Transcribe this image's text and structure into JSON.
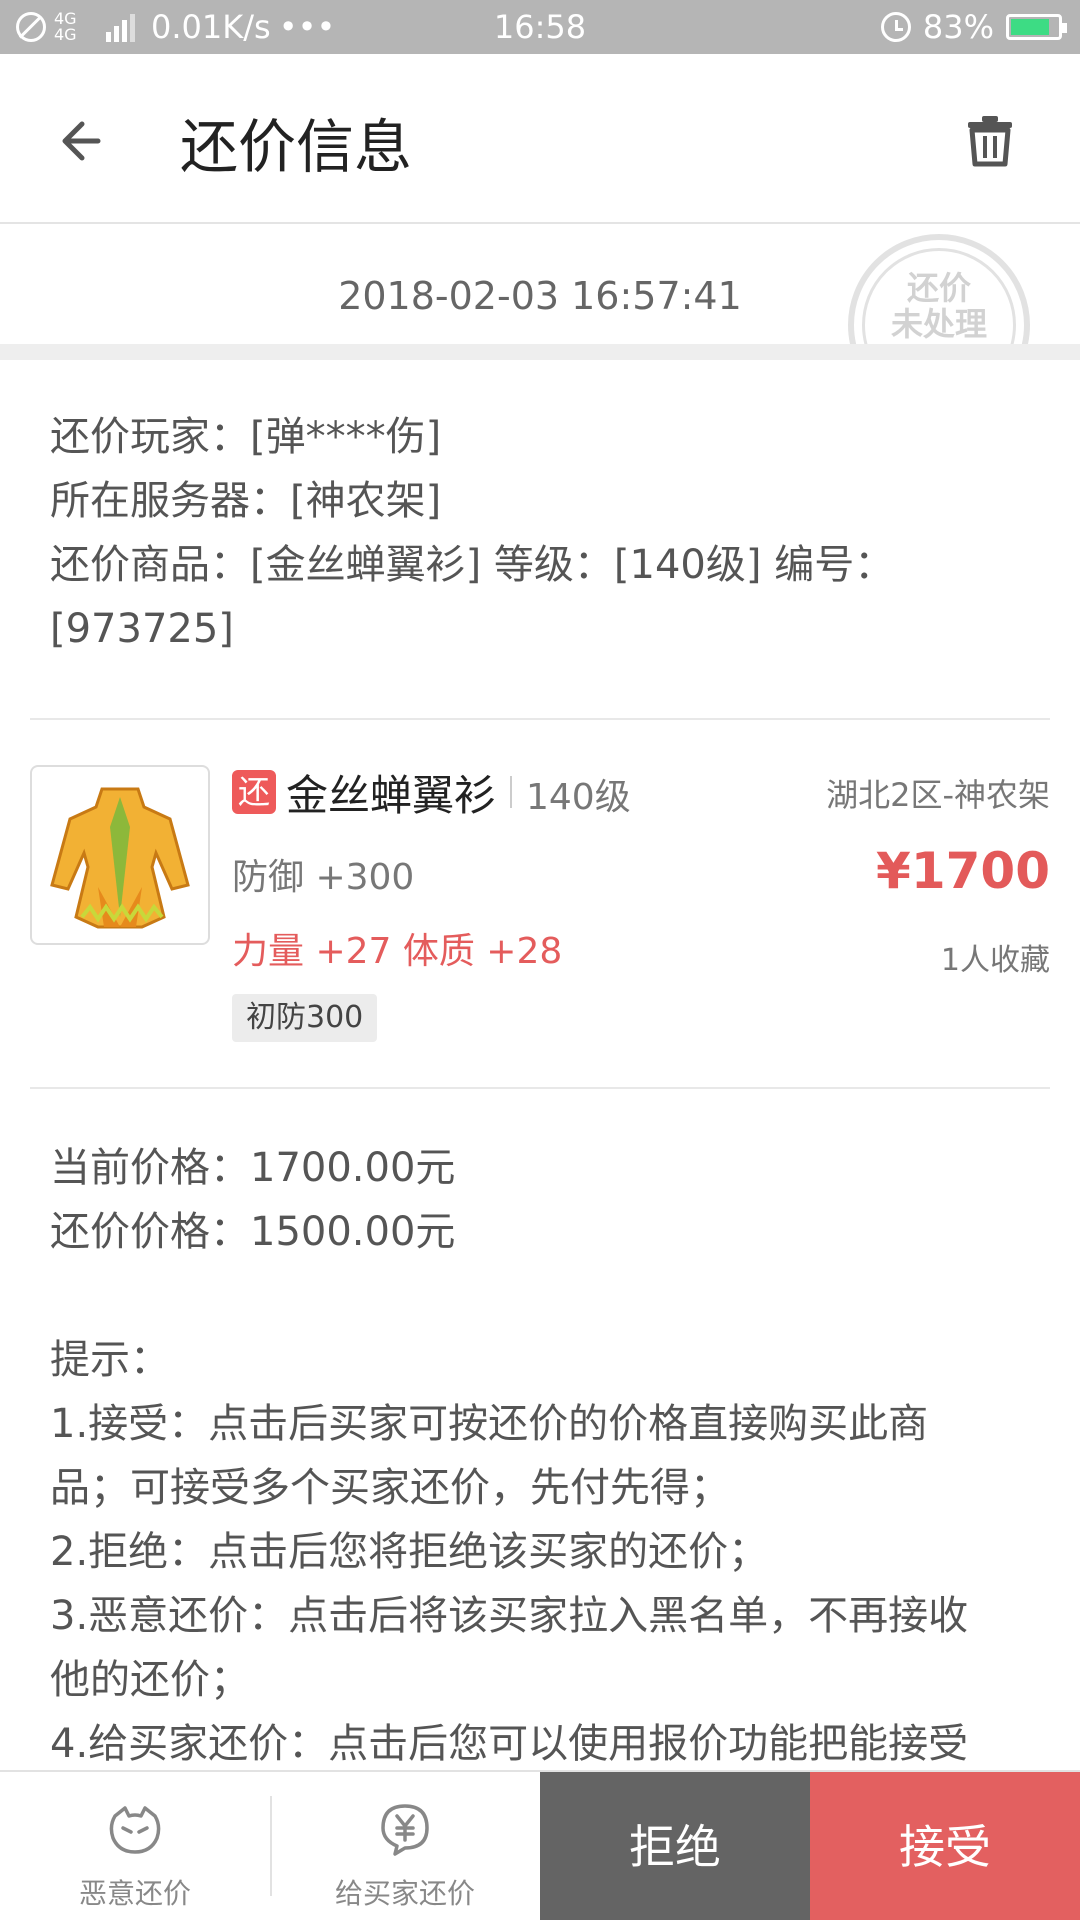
{
  "status_bar": {
    "network": "4G 4G",
    "speed": "0.01K/s",
    "more": "•••",
    "time": "16:58",
    "battery_text": "83%",
    "battery_level": 0.83
  },
  "header": {
    "title": "还价信息"
  },
  "offer_card": {
    "time": "2018-02-03 16:57:41",
    "stamp_line1": "还价",
    "stamp_line2": "未处理"
  },
  "info": {
    "player": "还价玩家：[弹****伤]",
    "server": "所在服务器：[神农架]",
    "goods_line1": "还价商品：[金丝蝉翼衫] 等级：[140级] 编号：",
    "goods_line2": "[973725]"
  },
  "item": {
    "tag": "还",
    "name": "金丝蝉翼衫",
    "level": "140级",
    "server": "湖北2区-神农架",
    "stat1": "防御 +300",
    "stat2": "力量 +27 体质 +28",
    "price": "¥1700",
    "favorites": "1人收藏",
    "chip": "初防300"
  },
  "prices": {
    "current": "当前价格：1700.00元",
    "offer": "还价价格：1500.00元"
  },
  "tips": {
    "title": "提示：",
    "line1": "1.接受：点击后买家可按还价的价格直接购买此商",
    "line2": "品；可接受多个买家还价，先付先得；",
    "line3": "2.拒绝：点击后您将拒绝该买家的还价；",
    "line4": "3.恶意还价：点击后将该买家拉入黑名单，不再接收",
    "line5": "他的还价；",
    "line6": "4.给买家还价：点击后您可以使用报价功能把能接受"
  },
  "bottom": {
    "malicious": "恶意还价",
    "counter": "给买家还价",
    "reject": "拒绝",
    "accept": "接受"
  },
  "colors": {
    "accent_red": "#e36060",
    "reject_gray": "#646464",
    "statusbar_gray": "#b5b5b5"
  }
}
